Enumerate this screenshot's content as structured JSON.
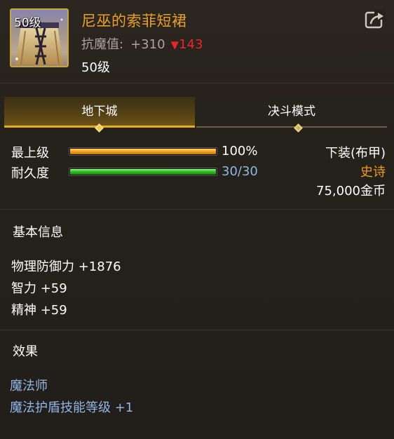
{
  "item": {
    "icon_level": "50级",
    "name": "尼巫的索菲短裙",
    "resist_label": "抗魔值:",
    "resist_value": "+310",
    "resist_diff_arrow": "▼",
    "resist_diff": "143",
    "level_text": "50级",
    "share_icon": "share-icon"
  },
  "tabs": [
    {
      "label": "地下城",
      "active": true
    },
    {
      "label": "决斗模式",
      "active": false
    }
  ],
  "stats": {
    "upgrade": {
      "label": "最上级",
      "value": "100%",
      "fraction": 1.0
    },
    "durability": {
      "label": "耐久度",
      "value": "30/30",
      "fraction": 1.0
    }
  },
  "info": {
    "type": "下装(布甲)",
    "rarity": "史诗",
    "price": "75,000金币"
  },
  "basic": {
    "title": "基本信息",
    "attributes": [
      "物理防御力 +1876",
      "智力 +59",
      "精神 +59"
    ]
  },
  "effects": {
    "title": "效果",
    "lines": [
      "魔法师",
      "魔法护盾技能等级 +1"
    ]
  },
  "colors": {
    "item_name": "#e9a02b",
    "rarity": "#ee9b1e",
    "decrease": "#e6262b",
    "effect_text": "#8fb6e6",
    "tab_active_underline": "#e2ad22"
  }
}
